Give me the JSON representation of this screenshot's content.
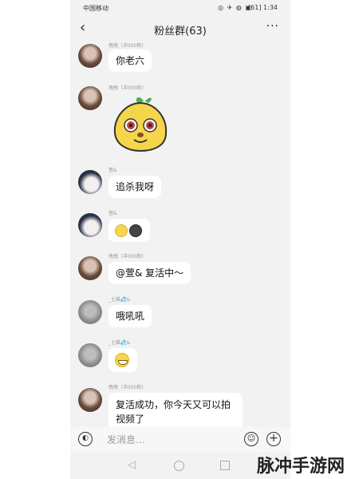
{
  "statusbar": {
    "carrier": "中国移动",
    "icons": "◎ ✈ ◍ ▣",
    "battery": "[61]",
    "time": "1:34"
  },
  "header": {
    "title": "粉丝群(63)",
    "back_icon": "‹",
    "more_icon": "···"
  },
  "messages": [
    {
      "sender": "拽拽（冲300粉）",
      "avatar": "girl",
      "text": "你老六"
    },
    {
      "sender": "拽拽（冲300粉）",
      "avatar": "girl",
      "sticker": "pear-face-sticker"
    },
    {
      "sender": "萱&",
      "avatar": "anime",
      "text": "追杀我呀"
    },
    {
      "sender": "萱&",
      "avatar": "anime",
      "emojis": [
        "relieved-emoji",
        "dark-face-emoji"
      ]
    },
    {
      "sender": "拽拽（冲300粉）",
      "avatar": "girl",
      "text": "@萱& 复活中～"
    },
    {
      "sender": "_七猫💦&",
      "avatar": "gray",
      "text": "哦吼吼"
    },
    {
      "sender": "_七猫💦&",
      "avatar": "gray",
      "emojis": [
        "grinning-emoji"
      ]
    },
    {
      "sender": "拽拽（冲300粉）",
      "avatar": "girl",
      "text": "复活成功，你今天又可以拍视频了"
    }
  ],
  "input": {
    "placeholder": "发消息…",
    "voice_icon": "voice-icon",
    "emoji_icon": "emoji-icon",
    "plus_icon": "plus-icon"
  },
  "watermark": "脉冲手游网",
  "colors": {
    "chat_bg": "#f2f2f2",
    "bubble_bg": "#ffffff",
    "sticker_yellow": "#f5d64a",
    "sticker_leaf": "#4caf50"
  }
}
